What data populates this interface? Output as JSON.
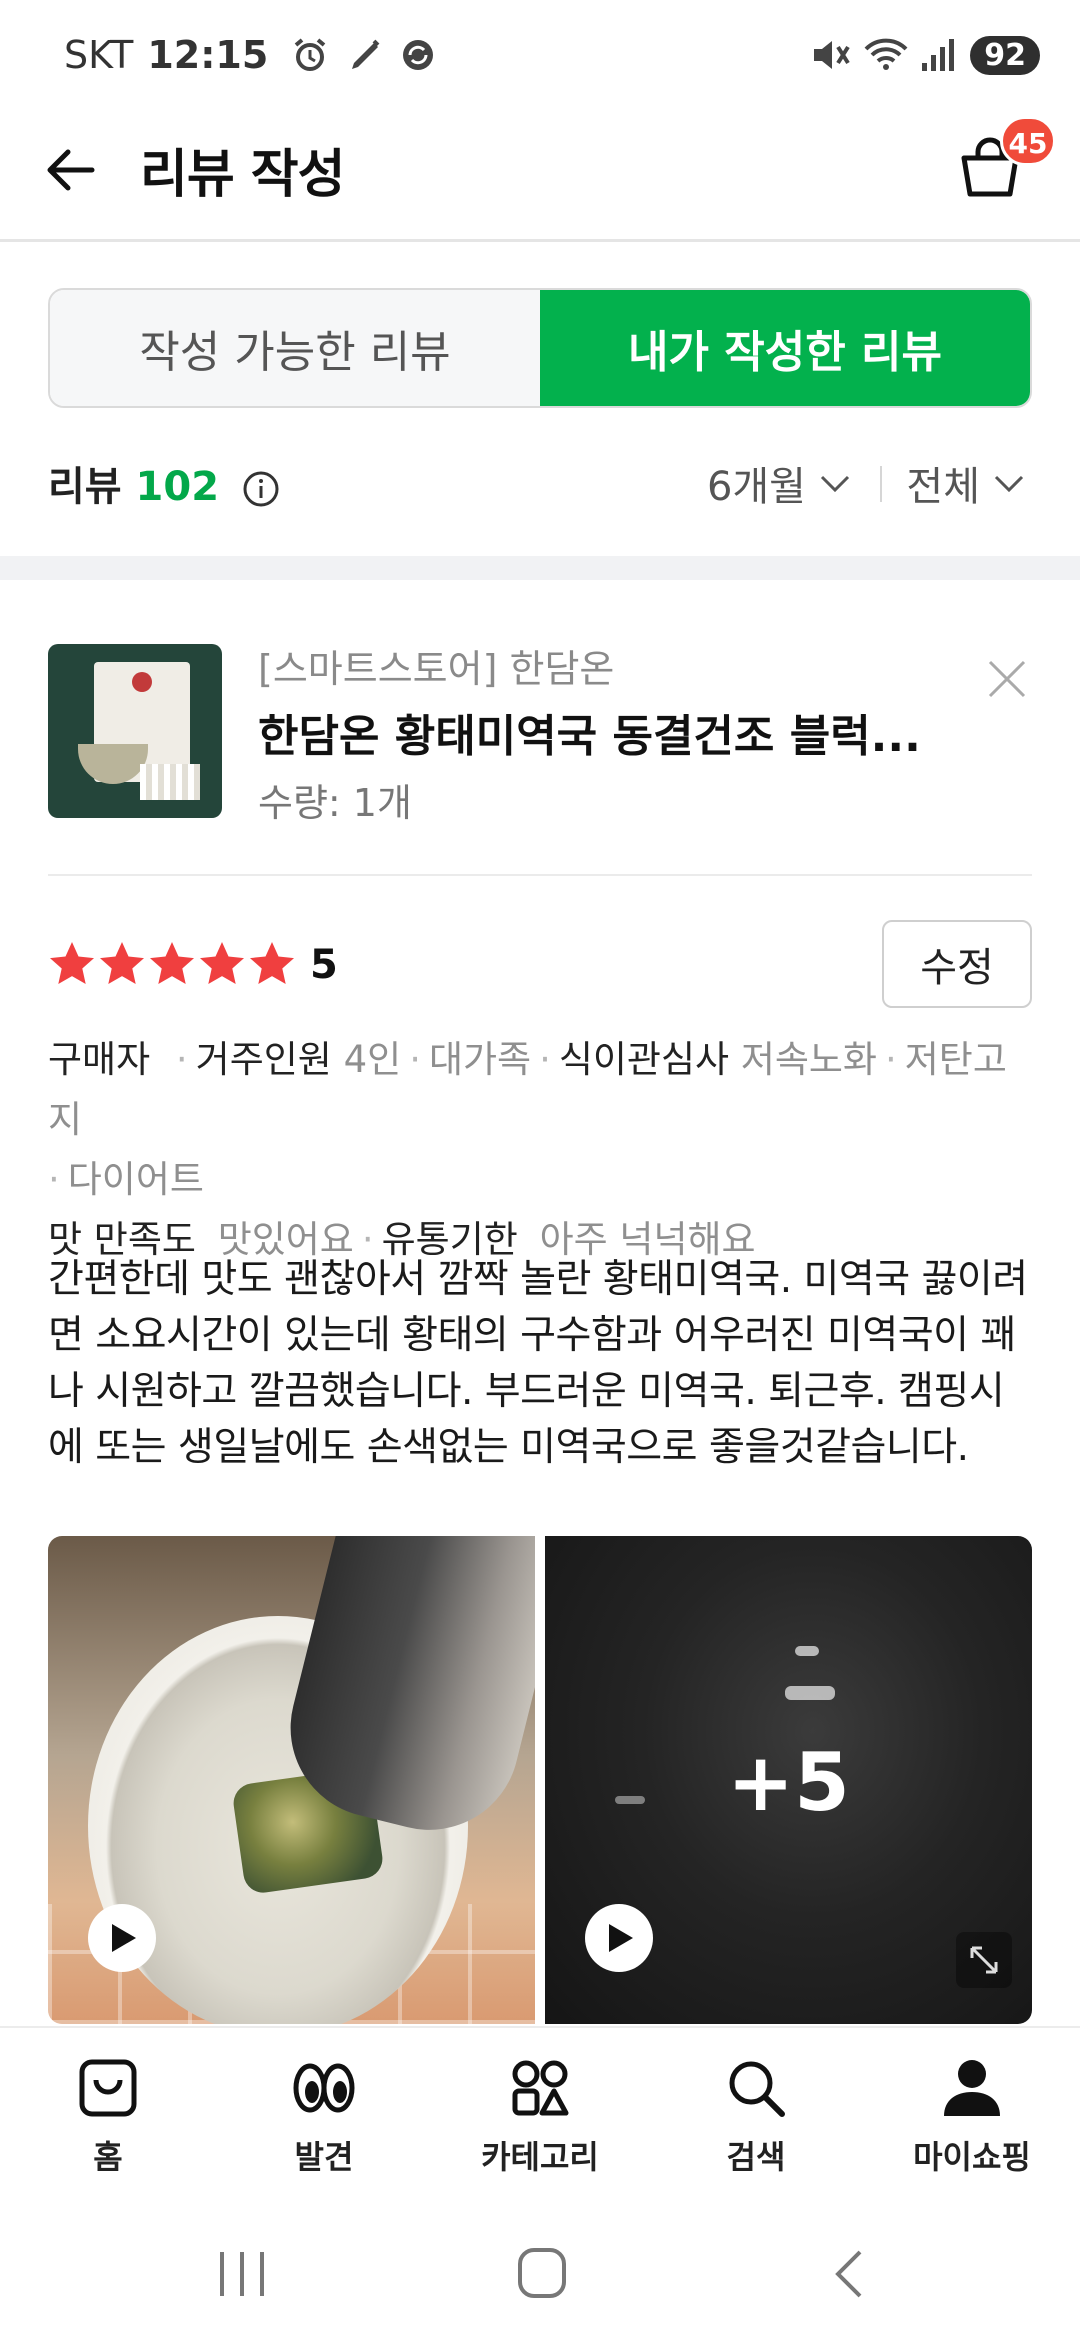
{
  "status_bar": {
    "carrier": "SKT",
    "time": "12:15",
    "battery": "92"
  },
  "header": {
    "title": "리뷰 작성",
    "cart_count": "45"
  },
  "tabs": [
    {
      "label": "작성 가능한 리뷰",
      "active": false
    },
    {
      "label": "내가 작성한 리뷰",
      "active": true
    }
  ],
  "reviews_summary": {
    "label": "리뷰",
    "count": "102",
    "period_filter": "6개월",
    "type_filter": "전체"
  },
  "product": {
    "store": "[스마트스토어] 한담온",
    "name": "한담온 황태미역국 동결건조 블럭...",
    "quantity": "수량: 1개"
  },
  "review": {
    "rating": "5",
    "edit_label": "수정",
    "reviewer_type": "구매자",
    "tags": {
      "household_key": "거주인원",
      "household_vals": [
        "4인",
        "대가족"
      ],
      "diet_key": "식이관심사",
      "diet_vals": [
        "저속노화",
        "저탄고지",
        "다이어트"
      ],
      "taste_key": "맛 만족도",
      "taste_val": "맛있어요",
      "expiry_key": "유통기한",
      "expiry_val": "아주 넉넉해요"
    },
    "text": "간편한데 맛도 괜찮아서 깜짝 놀란 황태미역국. 미역국 끓이려면 소요시간이 있는데 황태의 구수함과 어우러진 미역국이 꽤나 시원하고 깔끔했습니다. 부드러운 미역국. 퇴근후. 캠핑시에 또는 생일날에도 손색없는 미역국으로 좋을것같습니다.",
    "more_photos": "+5"
  },
  "bottom_nav": [
    {
      "label": "홈",
      "icon": "shopping-bag-icon"
    },
    {
      "label": "발견",
      "icon": "eyes-icon"
    },
    {
      "label": "카테고리",
      "icon": "category-grid-icon"
    },
    {
      "label": "검색",
      "icon": "search-icon"
    },
    {
      "label": "마이쇼핑",
      "icon": "person-icon"
    }
  ],
  "colors": {
    "accent_green": "#03b14d",
    "badge_red": "#f04b3a",
    "star_red": "#f03f3f"
  }
}
